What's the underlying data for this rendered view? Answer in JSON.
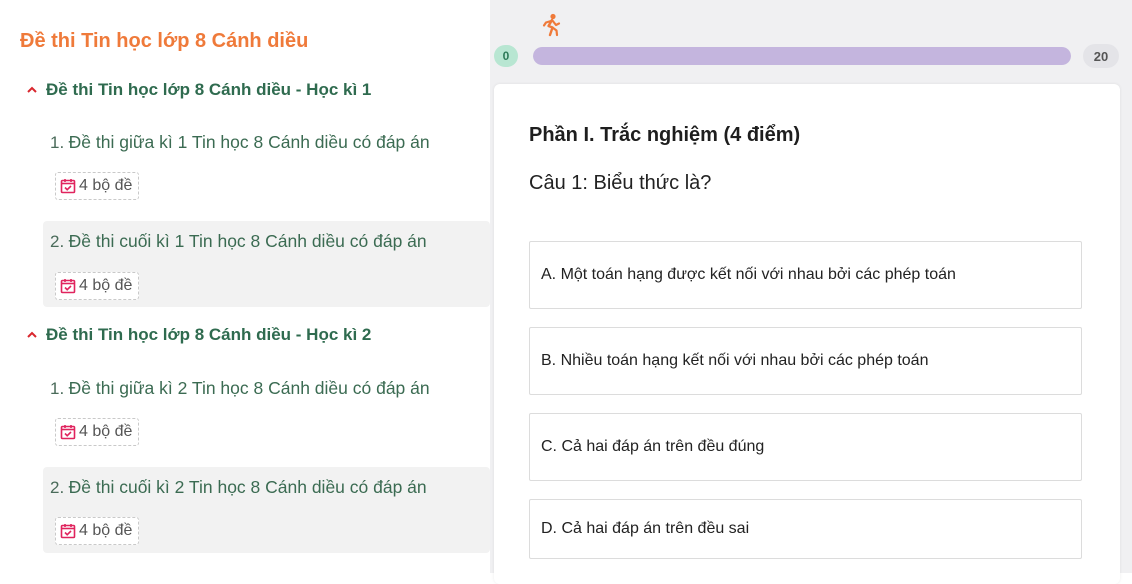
{
  "sidebar": {
    "title": "Đề thi Tin học lớp 8 Cánh diều",
    "sections": [
      {
        "title": "Đề thi Tin học lớp 8 Cánh diều - Học kì 1",
        "items": [
          {
            "num": "1.",
            "label": "Đề thi giữa kì 1 Tin học 8 Cánh diều có đáp án",
            "badge": "4 bộ đề"
          },
          {
            "num": "2.",
            "label": "Đề thi cuối kì 1 Tin học 8 Cánh diều có đáp án",
            "badge": "4 bộ đề"
          }
        ]
      },
      {
        "title": "Đề thi Tin học lớp 8 Cánh diều - Học kì 2",
        "items": [
          {
            "num": "1.",
            "label": "Đề thi giữa kì 2 Tin học 8 Cánh diều có đáp án",
            "badge": "4 bộ đề"
          },
          {
            "num": "2.",
            "label": "Đề thi cuối kì 2 Tin học 8 Cánh diều có đáp án",
            "badge": "4 bộ đề"
          }
        ]
      }
    ]
  },
  "progress": {
    "start_label": "0",
    "end_label": "20",
    "fraction": 1.0,
    "runner_icon": "running-person-icon",
    "accent": "#ef7a3a",
    "fill_color": "#c4b5de"
  },
  "quiz": {
    "part_title": "Phần I. Trắc nghiệm (4 điểm)",
    "question": "Câu 1: Biểu thức là?",
    "options": [
      "A. Một toán hạng được kết nối với nhau bởi các phép toán",
      "B. Nhiều toán hạng kết nối với nhau bởi các phép toán",
      "C. Cả hai đáp án trên đều đúng",
      "D. Cả hai đáp án trên đều sai"
    ]
  },
  "colors": {
    "title_orange": "#ef7a3a",
    "section_green": "#2f6b4f",
    "caret_red": "#d9272e",
    "badge_icon_pink": "#e0245e"
  }
}
